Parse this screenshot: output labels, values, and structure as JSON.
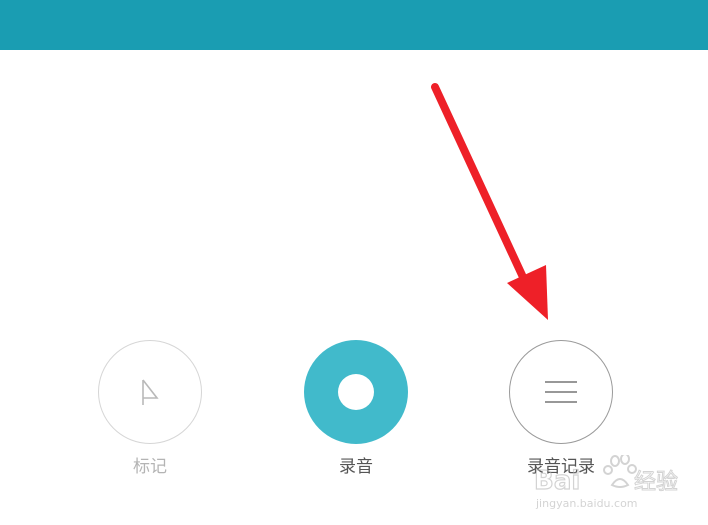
{
  "colors": {
    "top_bar": "#1a9db2",
    "record_button": "#41bacb",
    "annotation_arrow": "#ee2028"
  },
  "controls": [
    {
      "label": "标记",
      "icon": "flag-icon",
      "state": "disabled"
    },
    {
      "label": "录音",
      "icon": "record-icon",
      "state": "active"
    },
    {
      "label": "录音记录",
      "icon": "list-icon",
      "state": "enabled"
    }
  ],
  "watermark": {
    "text": "Baidu 经验",
    "url_text": "jingyan.baidu.com"
  }
}
